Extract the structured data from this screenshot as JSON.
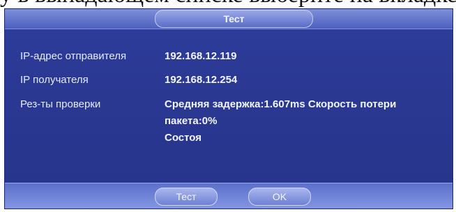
{
  "dialog": {
    "title": "Тест",
    "fields": [
      {
        "label": "IP-адрес отправителя",
        "value": "192.168.12.119"
      },
      {
        "label": "IP получателя",
        "value": "192.168.12.254"
      },
      {
        "label": "Рез-ты проверки",
        "value_line1": "Средняя задержка:1.607ms  Скорость потери",
        "value_line2": "пакета:0%",
        "value_line3": "Состоя"
      }
    ],
    "buttons": {
      "test_label": "Тест",
      "ok_label": "OK"
    }
  },
  "colors": {
    "dialog_bg": "#2a3892",
    "title_bar": "#6478d0",
    "text": "#f4f6ff"
  }
}
